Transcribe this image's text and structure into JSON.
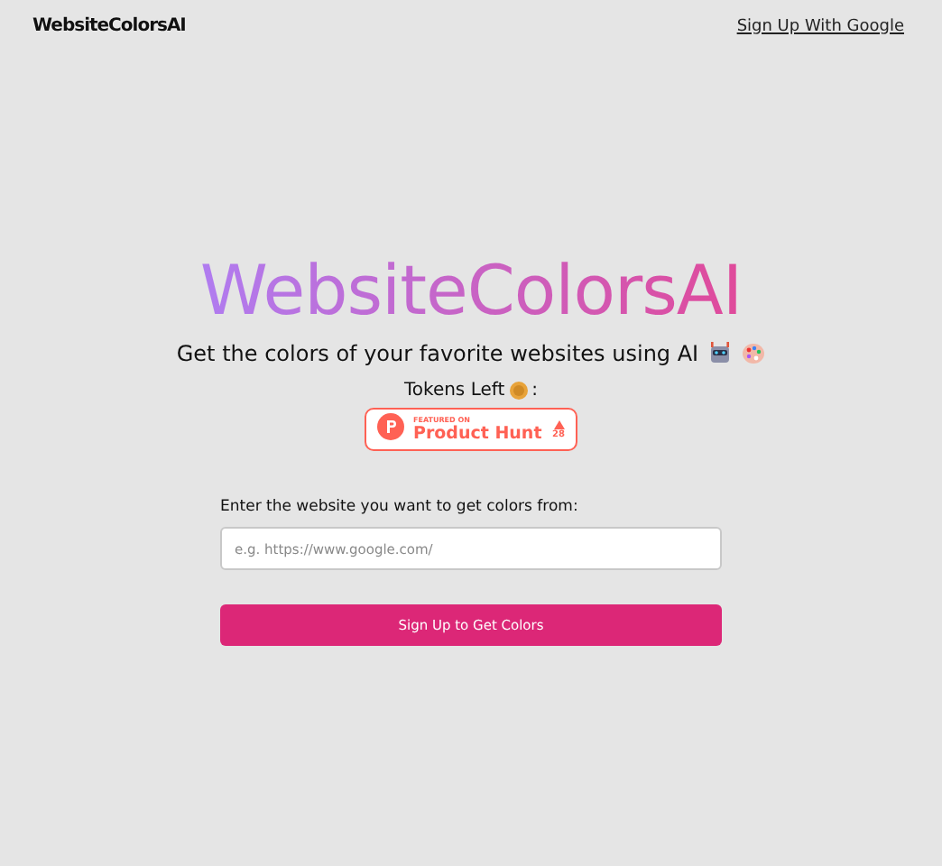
{
  "header": {
    "logo": "WebsiteColorsAI",
    "link": "Sign Up With Google"
  },
  "hero": {
    "title": "WebsiteColorsAI",
    "subtitle": "Get the colors of your favorite websites using AI",
    "tokens_label": "Tokens Left",
    "tokens_suffix": ":"
  },
  "badge": {
    "small": "FEATURED ON",
    "name": "Product Hunt",
    "votes": "28"
  },
  "form": {
    "label": "Enter the website you want to get colors from:",
    "placeholder": "e.g. https://www.google.com/",
    "button": "Sign Up to Get Colors"
  }
}
